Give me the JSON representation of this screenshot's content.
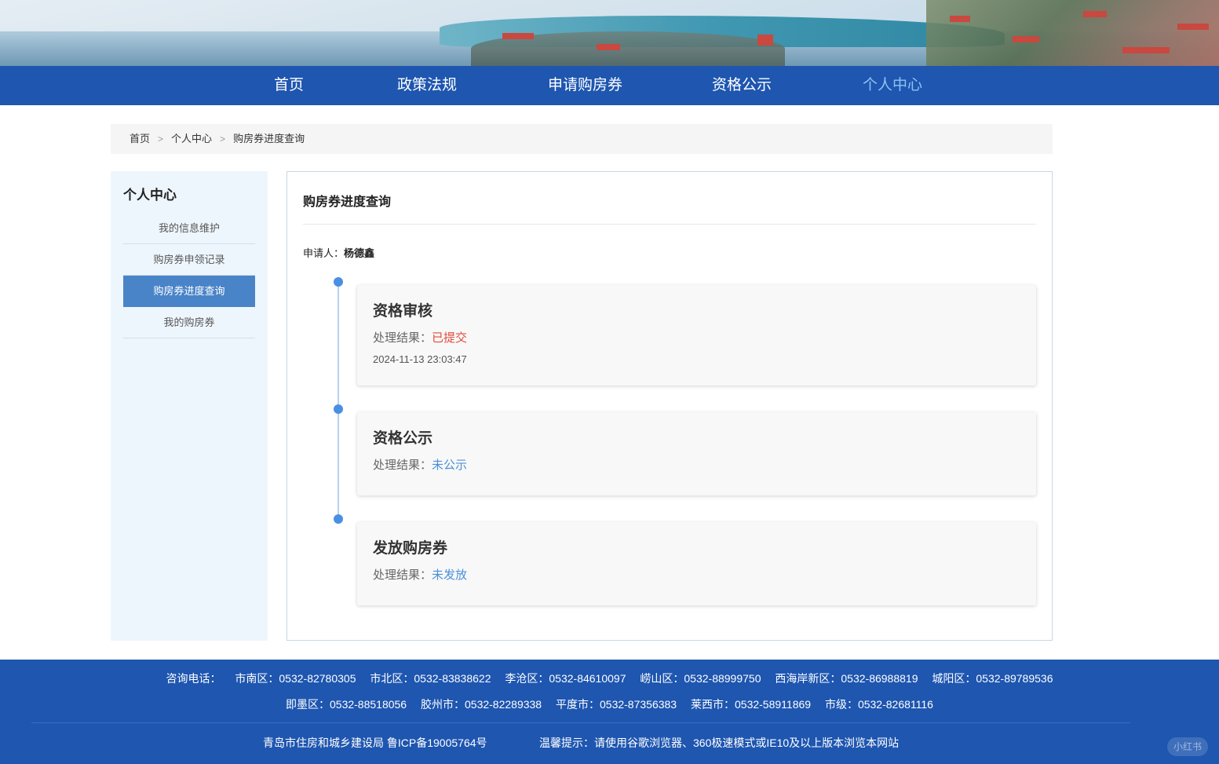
{
  "nav": {
    "items": [
      {
        "label": "首页"
      },
      {
        "label": "政策法规"
      },
      {
        "label": "申请购房券"
      },
      {
        "label": "资格公示"
      },
      {
        "label": "个人中心"
      }
    ],
    "active_color": "#8fc2f2",
    "bg_color": "#1e56b0"
  },
  "breadcrumb": [
    "首页",
    "个人中心",
    "购房券进度查询"
  ],
  "sidebar": {
    "title": "个人中心",
    "items": [
      {
        "label": "我的信息维护"
      },
      {
        "label": "购房券申领记录"
      },
      {
        "label": "购房券进度查询"
      },
      {
        "label": "我的购房券"
      }
    ]
  },
  "main": {
    "title": "购房券进度查询",
    "applicant_label": "申请人：",
    "applicant_name": "杨德鑫",
    "timeline": [
      {
        "title": "资格审核",
        "result_label": "处理结果：",
        "result": "已提交",
        "date": "2024-11-13 23:03:47"
      },
      {
        "title": "资格公示",
        "result_label": "处理结果：",
        "result": "未公示"
      },
      {
        "title": "发放购房券",
        "result_label": "处理结果：",
        "result": "未发放"
      }
    ]
  },
  "footer": {
    "phone_label": "咨询电话：",
    "phones_row1": [
      "市南区：0532-82780305",
      "市北区：0532-83838622",
      "李沧区：0532-84610097",
      "崂山区：0532-88999750",
      "西海岸新区：0532-86988819",
      "城阳区：0532-89789536"
    ],
    "phones_row2": [
      "即墨区：0532-88518056",
      "胶州市：0532-82289338",
      "平度市：0532-87356383",
      "莱西市：0532-58911869",
      "市级：0532-82681116"
    ],
    "copyright": "青岛市住房和城乡建设局 鲁ICP备19005764号",
    "tip": "温馨提示：请使用谷歌浏览器、360极速模式或IE10及以上版本浏览本网站",
    "watermark": "小红书"
  }
}
